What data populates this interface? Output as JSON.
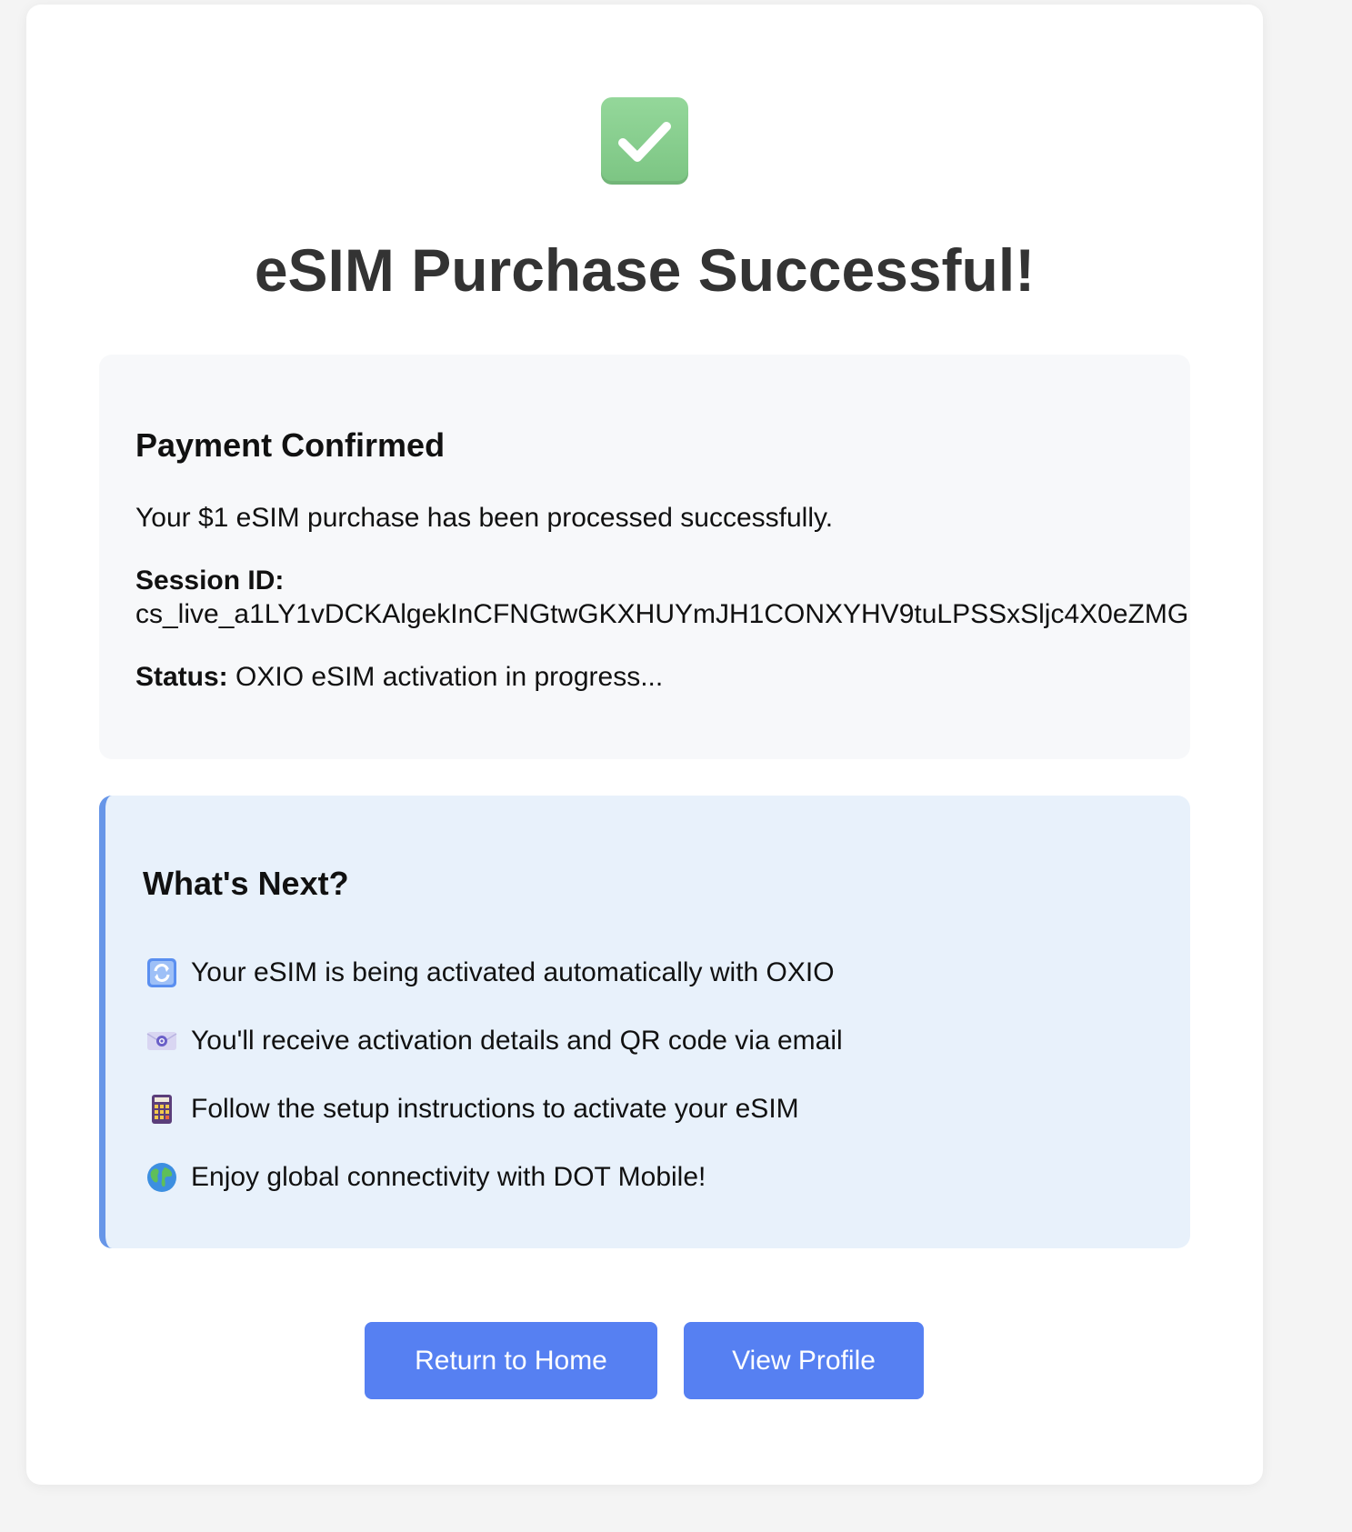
{
  "page": {
    "title": "eSIM Purchase Successful!"
  },
  "payment": {
    "heading": "Payment Confirmed",
    "message": "Your $1 eSIM purchase has been processed successfully.",
    "session_label": "Session ID:",
    "session_id": "cs_live_a1LY1vDCKAlgekInCFNGtwGKXHUYmJH1CONXYHV9tuLPSSxSljc4X0eZMG",
    "status_label": "Status:",
    "status_value": " OXIO eSIM activation in progress..."
  },
  "next": {
    "heading": "What's Next?",
    "items": [
      {
        "icon": "refresh-icon",
        "text": "Your eSIM is being activated automatically with OXIO"
      },
      {
        "icon": "email-icon",
        "text": "You'll receive activation details and QR code via email"
      },
      {
        "icon": "calculator-icon",
        "text": "Follow the setup instructions to activate your eSIM"
      },
      {
        "icon": "globe-icon",
        "text": "Enjoy global connectivity with DOT Mobile!"
      }
    ]
  },
  "actions": {
    "home_label": "Return to Home",
    "profile_label": "View Profile"
  },
  "colors": {
    "accent": "#5680f2",
    "success": "#7cc583",
    "info_bg": "#e8f1fb",
    "info_border": "#6796e8"
  }
}
